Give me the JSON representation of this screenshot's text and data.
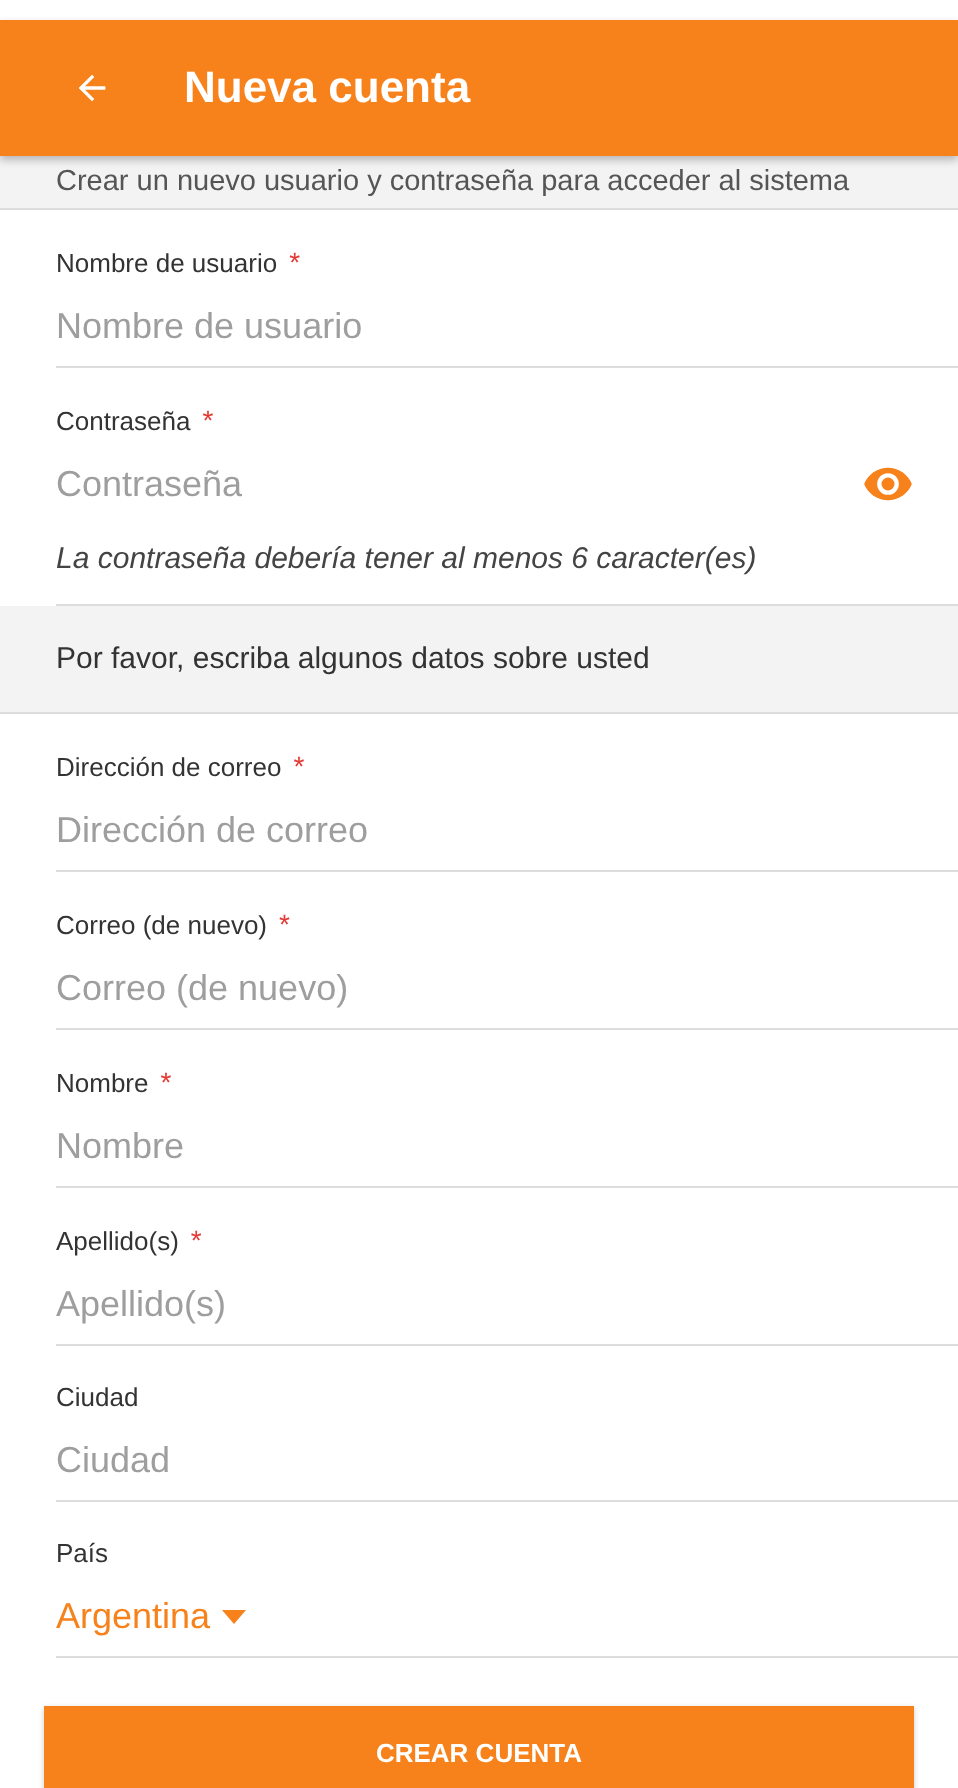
{
  "header": {
    "title": "Nueva cuenta"
  },
  "intro": "Crear un nuevo usuario y contraseña para acceder al sistema",
  "sections": [
    {
      "fields": [
        {
          "kind": "text",
          "label": "Nombre de usuario",
          "required_mark": "*",
          "placeholder": "Nombre de usuario"
        },
        {
          "kind": "password",
          "label": "Contraseña",
          "required_mark": "*",
          "placeholder": "Contraseña",
          "hint": "La contraseña debería tener al menos 6 caracter(es)"
        }
      ]
    },
    {
      "note": "Por favor, escriba algunos datos sobre usted",
      "fields": [
        {
          "kind": "text",
          "label": "Dirección de correo",
          "required_mark": "*",
          "placeholder": "Dirección de correo"
        },
        {
          "kind": "text",
          "label": "Correo (de nuevo)",
          "required_mark": "*",
          "placeholder": "Correo (de nuevo)"
        },
        {
          "kind": "text",
          "label": "Nombre",
          "required_mark": "*",
          "placeholder": "Nombre"
        },
        {
          "kind": "text",
          "label": "Apellido(s)",
          "required_mark": "*",
          "placeholder": "Apellido(s)"
        },
        {
          "kind": "text",
          "label": "Ciudad",
          "placeholder": "Ciudad"
        },
        {
          "kind": "select",
          "label": "País",
          "value": "Argentina"
        }
      ]
    }
  ],
  "submit": "CREAR CUENTA"
}
